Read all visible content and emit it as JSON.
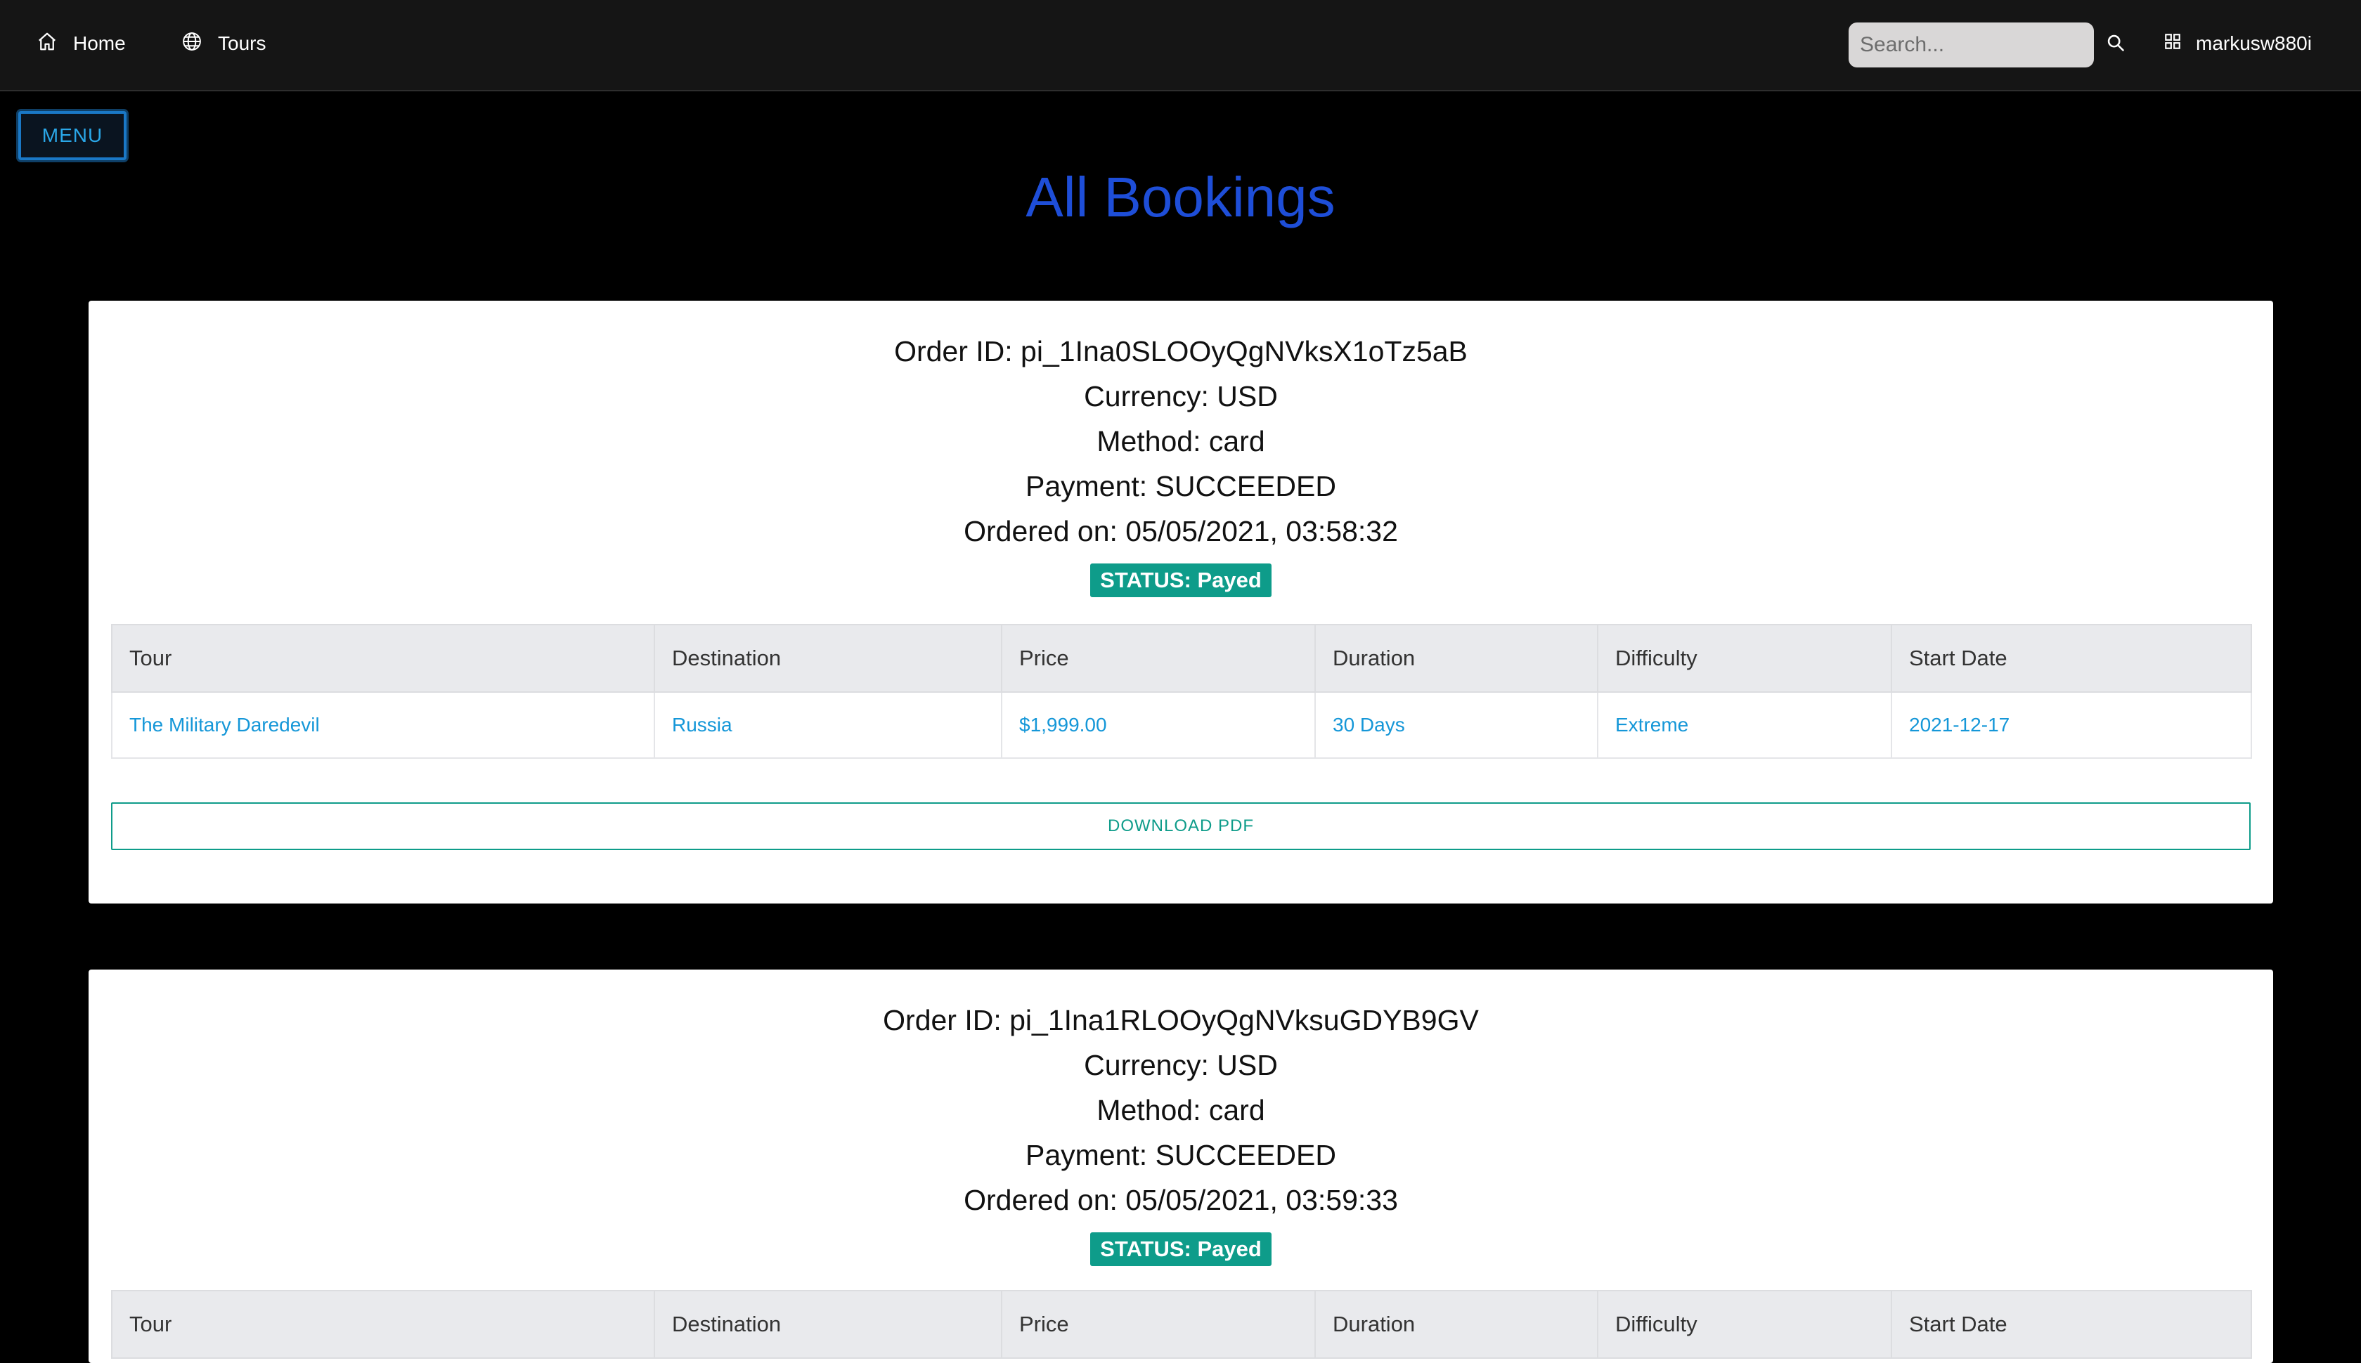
{
  "nav": {
    "home_label": "Home",
    "tours_label": "Tours",
    "search_placeholder": "Search...",
    "username": "markusw880i",
    "icons": [
      "home-icon",
      "globe-icon",
      "search-icon",
      "grid-icon"
    ]
  },
  "menu_button_label": "MENU",
  "page_title": "All Bookings",
  "table_headers": [
    "Tour",
    "Destination",
    "Price",
    "Duration",
    "Difficulty",
    "Start Date"
  ],
  "download_label": "DOWNLOAD PDF",
  "colors": {
    "title": "#1e4ed8",
    "status_badge": "#0e9c8a",
    "link_text": "#1597d8",
    "navbar": "#151515"
  },
  "bookings": [
    {
      "order_id": "Order ID: pi_1Ina0SLOOyQgNVksX1oTz5aB",
      "currency": "Currency: USD",
      "method": "Method: card",
      "payment": "Payment: SUCCEEDED",
      "ordered_on": "Ordered on: 05/05/2021, 03:58:32",
      "status": "STATUS: Payed",
      "row": {
        "tour": "The Military Daredevil",
        "destination": "Russia",
        "price": "$1,999.00",
        "duration": "30 Days",
        "difficulty": "Extreme",
        "start_date": "2021-12-17"
      }
    },
    {
      "order_id": "Order ID: pi_1Ina1RLOOyQgNVksuGDYB9GV",
      "currency": "Currency: USD",
      "method": "Method: card",
      "payment": "Payment: SUCCEEDED",
      "ordered_on": "Ordered on: 05/05/2021, 03:59:33",
      "status": "STATUS: Payed"
    }
  ]
}
